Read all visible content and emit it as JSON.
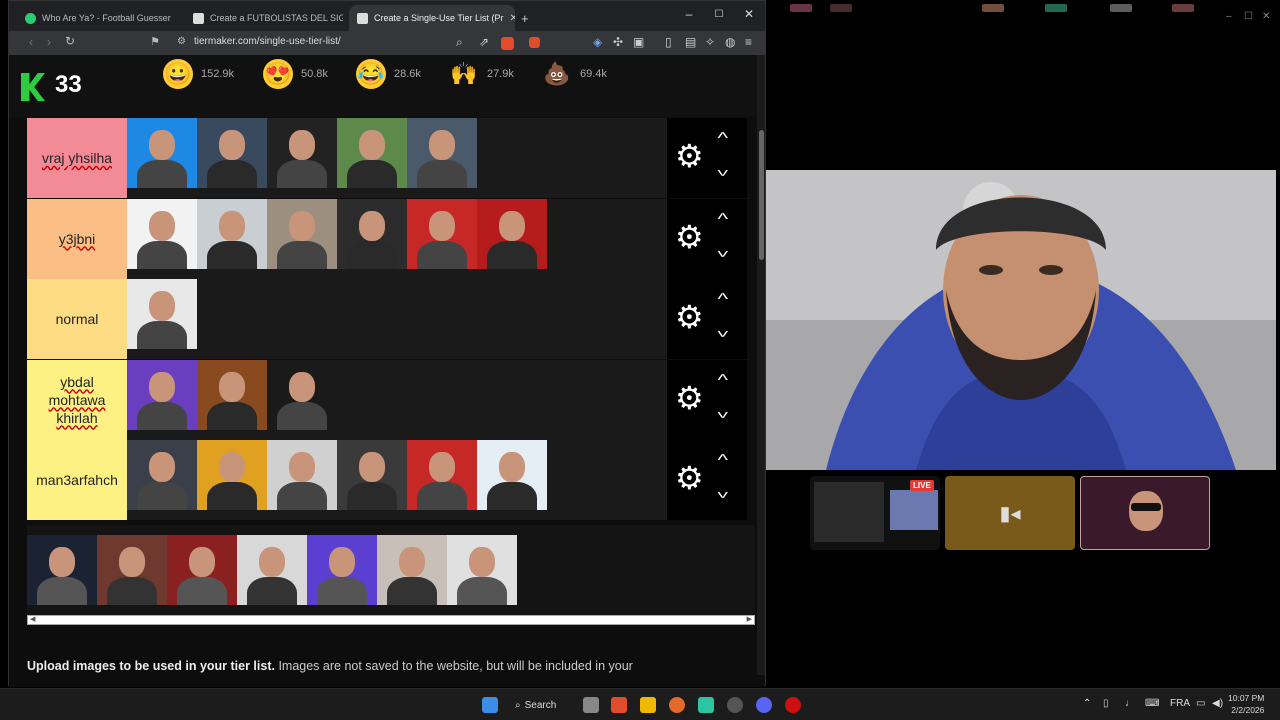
{
  "browser": {
    "tabs": [
      {
        "label": "Who Are Ya? - Football Guesser",
        "color": "#2ecc71"
      },
      {
        "label": "Create a FUTBOLISTAS DEL SIGLO Tie",
        "color": "#e0e0e0"
      },
      {
        "label": "Create a Single-Use Tier List (Pr",
        "color": "#e0e0e0"
      }
    ],
    "new_tab": "+",
    "url": "tiermaker.com/single-use-tier-list/",
    "window": {
      "minimize": "–",
      "maximize": "☐",
      "close": "✕"
    }
  },
  "header": {
    "score": "33",
    "reactions": [
      {
        "icon": "grinning-face-icon",
        "count": "152.9k"
      },
      {
        "icon": "heart-eyes-icon",
        "count": "50.8k"
      },
      {
        "icon": "laughing-tears-icon",
        "count": "28.6k"
      },
      {
        "icon": "raised-hands-icon",
        "count": "27.9k"
      },
      {
        "icon": "pile-of-poo-icon",
        "count": "69.4k"
      }
    ]
  },
  "tiers": [
    {
      "label": "vraj yhsilha",
      "color": "#f28b96",
      "count": 5
    },
    {
      "label": "y3jbni",
      "color": "#fbbe84",
      "count": 6
    },
    {
      "label": "normal",
      "color": "#fddc84",
      "count": 1
    },
    {
      "label": "ybdal mohtawa khirlah",
      "color": "#fdf184",
      "count": 3
    },
    {
      "label": "man3arfahch",
      "color": "#fdf184",
      "count": 6
    }
  ],
  "tier_thumb_colors": [
    [
      "#1e88e5",
      "#3a4a5e",
      "#222222",
      "#5d8a4a",
      "#4a5a6a"
    ],
    [
      "#f2f2f2",
      "#c9ced3",
      "#9c8f80",
      "#2c2c2c",
      "#c62828",
      "#b71c1c"
    ],
    [
      "#e8e8e8"
    ],
    [
      "#6a3fbf",
      "#8a4a20",
      "#1a1a1a"
    ],
    [
      "#3a3f4a",
      "#e0a020",
      "#d0d0d0",
      "#3a3a3a",
      "#c62828",
      "#e6eef5"
    ]
  ],
  "pool_thumb_colors": [
    "#1b2333",
    "#6e3a30",
    "#8a2020",
    "#d8d8d8",
    "#5a3fd0",
    "#c8c0b8",
    "#e0e0e0"
  ],
  "upload": {
    "bold": "Upload images to be used in your tier list.",
    "rest": " Images are not saved to the website, but will be included in your"
  },
  "stream": {
    "live_badge": "LIVE"
  },
  "taskbar": {
    "search": "Search",
    "lang": "FRA",
    "time": "10:07 PM",
    "date": "2/2/2026"
  },
  "scroll": {
    "left": "◀",
    "right": "▶"
  }
}
